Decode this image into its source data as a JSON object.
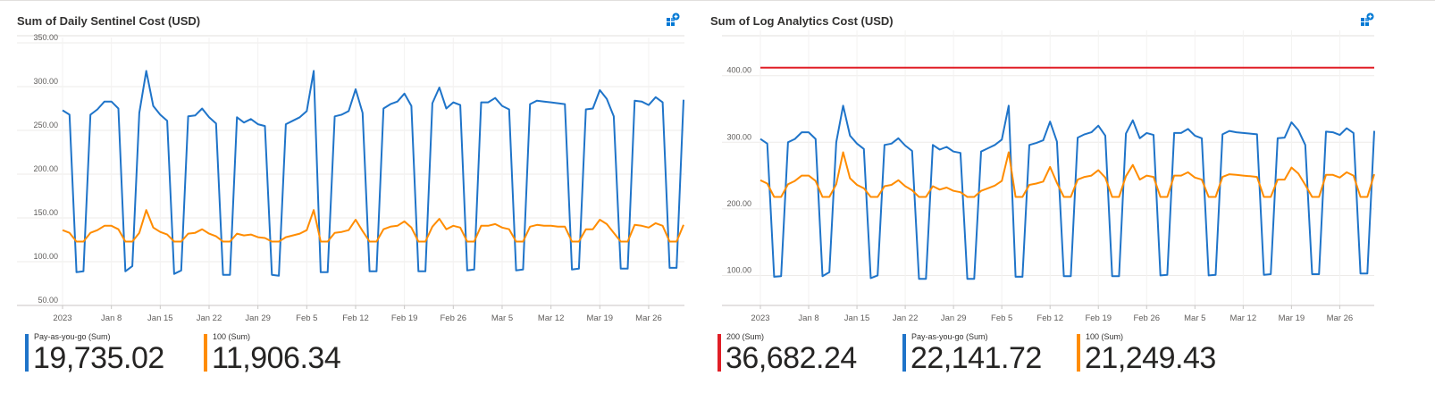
{
  "chart_data": [
    {
      "type": "line",
      "title": "Sum of Daily Sentinel Cost (USD)",
      "ylim": [
        50,
        350
      ],
      "yticks": [
        "50.00",
        "100.00",
        "150.00",
        "200.00",
        "250.00",
        "300.00",
        "350.00"
      ],
      "ytick_values": [
        50,
        100,
        150,
        200,
        250,
        300,
        350
      ],
      "xticks": [
        "2023",
        "Jan 8",
        "Jan 15",
        "Jan 22",
        "Jan 29",
        "Feb 5",
        "Feb 12",
        "Feb 19",
        "Feb 26",
        "Mar 5",
        "Mar 12",
        "Mar 19",
        "Mar 26"
      ],
      "x_start": "2023-01-01",
      "grid": true,
      "series": [
        {
          "name": "Pay-as-you-go (Sum)",
          "color": "#1f74c9",
          "values": [
            273,
            268,
            88,
            89,
            268,
            274,
            283,
            283,
            275,
            89,
            95,
            270,
            318,
            278,
            268,
            261,
            86,
            90,
            266,
            267,
            275,
            265,
            258,
            85,
            85,
            265,
            259,
            263,
            257,
            255,
            85,
            84,
            257,
            261,
            265,
            272,
            318,
            88,
            88,
            266,
            268,
            272,
            297,
            270,
            89,
            89,
            275,
            280,
            283,
            292,
            278,
            89,
            89,
            281,
            299,
            275,
            282,
            279,
            90,
            91,
            282,
            282,
            287,
            278,
            274,
            90,
            91,
            280,
            284,
            283,
            282,
            281,
            280,
            91,
            92,
            274,
            275,
            296,
            286,
            266,
            92,
            92,
            284,
            283,
            279,
            288,
            282,
            93,
            93,
            285
          ]
        },
        {
          "name": "100 (Sum)",
          "color": "#ff8c00",
          "values": [
            136,
            133,
            123,
            123,
            133,
            136,
            141,
            141,
            137,
            123,
            123,
            133,
            159,
            139,
            134,
            131,
            123,
            123,
            132,
            133,
            137,
            132,
            129,
            123,
            123,
            132,
            130,
            131,
            128,
            127,
            123,
            123,
            128,
            130,
            132,
            136,
            159,
            123,
            123,
            133,
            134,
            136,
            148,
            135,
            123,
            123,
            137,
            140,
            141,
            146,
            139,
            123,
            123,
            140,
            149,
            137,
            141,
            139,
            123,
            123,
            141,
            141,
            143,
            139,
            137,
            123,
            123,
            140,
            142,
            141,
            141,
            140,
            140,
            123,
            123,
            137,
            137,
            148,
            143,
            133,
            123,
            123,
            142,
            141,
            139,
            144,
            141,
            123,
            123,
            142
          ]
        }
      ],
      "legend": [
        {
          "label": "Pay-as-you-go (Sum)",
          "value": "19,735.02",
          "color": "#1f74c9"
        },
        {
          "label": "100 (Sum)",
          "value": "11,906.34",
          "color": "#ff8c00"
        }
      ]
    },
    {
      "type": "line",
      "title": "Sum of Log Analytics Cost (USD)",
      "ylim": [
        55,
        460
      ],
      "yticks": [
        "100.00",
        "200.00",
        "300.00",
        "400.00"
      ],
      "ytick_values": [
        100,
        200,
        300,
        400
      ],
      "xticks": [
        "2023",
        "Jan 8",
        "Jan 15",
        "Jan 22",
        "Jan 29",
        "Feb 5",
        "Feb 12",
        "Feb 19",
        "Feb 26",
        "Mar 5",
        "Mar 12",
        "Mar 19",
        "Mar 26"
      ],
      "x_start": "2023-01-01",
      "grid": true,
      "series": [
        {
          "name": "200 (Sum)",
          "color": "#e01e26",
          "values": [
            412,
            412
          ]
        },
        {
          "name": "Pay-as-you-go (Sum)",
          "color": "#1f74c9",
          "values": [
            305,
            298,
            98,
            99,
            300,
            305,
            315,
            315,
            305,
            99,
            105,
            300,
            355,
            310,
            298,
            290,
            96,
            100,
            296,
            298,
            306,
            295,
            287,
            95,
            95,
            296,
            289,
            293,
            286,
            284,
            95,
            95,
            286,
            291,
            296,
            304,
            355,
            98,
            98,
            296,
            299,
            303,
            331,
            301,
            99,
            99,
            307,
            312,
            315,
            325,
            310,
            99,
            99,
            313,
            333,
            306,
            314,
            311,
            100,
            101,
            314,
            314,
            320,
            310,
            306,
            100,
            101,
            312,
            317,
            315,
            314,
            313,
            312,
            101,
            102,
            306,
            307,
            330,
            318,
            296,
            102,
            102,
            316,
            315,
            311,
            321,
            314,
            103,
            103,
            317
          ]
        },
        {
          "name": "100 (Sum)",
          "color": "#ff8c00",
          "values": [
            243,
            238,
            218,
            218,
            237,
            242,
            250,
            250,
            242,
            218,
            218,
            237,
            285,
            246,
            236,
            231,
            218,
            218,
            234,
            236,
            243,
            234,
            228,
            218,
            218,
            234,
            229,
            232,
            227,
            225,
            218,
            218,
            227,
            231,
            235,
            242,
            285,
            218,
            218,
            236,
            238,
            241,
            263,
            239,
            218,
            218,
            244,
            248,
            250,
            258,
            247,
            218,
            218,
            249,
            266,
            244,
            250,
            248,
            218,
            218,
            250,
            250,
            255,
            247,
            244,
            218,
            218,
            248,
            252,
            251,
            250,
            249,
            248,
            218,
            218,
            244,
            244,
            262,
            253,
            236,
            218,
            218,
            251,
            251,
            247,
            255,
            250,
            218,
            218,
            252
          ]
        }
      ],
      "legend": [
        {
          "label": "200 (Sum)",
          "value": "36,682.24",
          "color": "#e01e26"
        },
        {
          "label": "Pay-as-you-go (Sum)",
          "value": "22,141.72",
          "color": "#1f74c9"
        },
        {
          "label": "100 (Sum)",
          "value": "21,249.43",
          "color": "#ff8c00"
        }
      ]
    }
  ],
  "pin_icon": "pin-to-dashboard-icon"
}
